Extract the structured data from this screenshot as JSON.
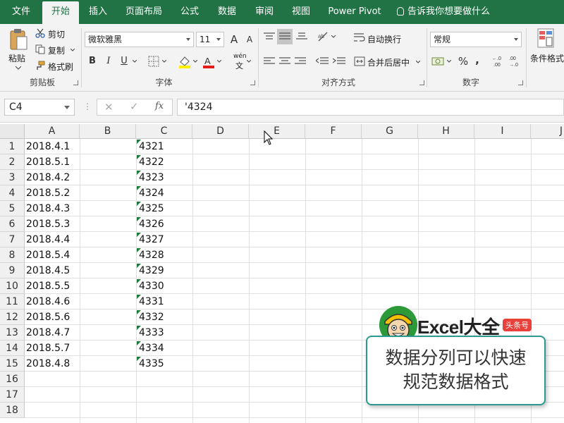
{
  "tabs": [
    {
      "label": "文件",
      "active": false
    },
    {
      "label": "开始",
      "active": true
    },
    {
      "label": "插入",
      "active": false
    },
    {
      "label": "页面布局",
      "active": false
    },
    {
      "label": "公式",
      "active": false
    },
    {
      "label": "数据",
      "active": false
    },
    {
      "label": "审阅",
      "active": false
    },
    {
      "label": "视图",
      "active": false
    },
    {
      "label": "Power Pivot",
      "active": false
    }
  ],
  "tell_me": "告诉我你想要做什么",
  "ribbon": {
    "clipboard": {
      "paste": "粘贴",
      "cut": "剪切",
      "copy": "复制",
      "format_painter": "格式刷",
      "label": "剪贴板"
    },
    "font": {
      "name": "微软雅黑",
      "size": "11",
      "grow": "A",
      "shrink": "A",
      "bold": "B",
      "italic": "I",
      "underline": "U",
      "wen": "wén",
      "wen_char": "文",
      "label": "字体"
    },
    "alignment": {
      "wrap": "自动换行",
      "merge": "合并后居中",
      "label": "对齐方式"
    },
    "number": {
      "format": "常规",
      "percent": "%",
      "comma": ",",
      "inc_decimal": "←.0\n.00",
      "dec_decimal": ".00\n→.0",
      "label": "数字"
    },
    "styles": {
      "conditional": "条件格式"
    }
  },
  "formula_bar": {
    "name_box": "C4",
    "cancel": "✕",
    "enter": "✓",
    "fx": "fx",
    "content": "'4324"
  },
  "columns": [
    "A",
    "B",
    "C",
    "D",
    "E",
    "F",
    "G",
    "H",
    "I",
    "J"
  ],
  "rows": [
    "1",
    "2",
    "3",
    "4",
    "5",
    "6",
    "7",
    "8",
    "9",
    "10",
    "11",
    "12",
    "13",
    "14",
    "15",
    "16",
    "17",
    "18"
  ],
  "cells": {
    "A": [
      "2018.4.1",
      "2018.5.1",
      "2018.4.2",
      "2018.5.2",
      "2018.4.3",
      "2018.5.3",
      "2018.4.4",
      "2018.5.4",
      "2018.4.5",
      "2018.5.5",
      "2018.4.6",
      "2018.5.6",
      "2018.4.7",
      "2018.5.7",
      "2018.4.8"
    ],
    "C": [
      "4321",
      "4322",
      "4323",
      "4324",
      "4325",
      "4326",
      "4327",
      "4328",
      "4329",
      "4330",
      "4331",
      "4332",
      "4333",
      "4334",
      "4335"
    ]
  },
  "overlay": {
    "logo_text": "Excel大全",
    "badge": "头条号",
    "callout_line1": "数据分列可以快速",
    "callout_line2": "规范数据格式"
  },
  "colors": {
    "excel_green": "#217346",
    "indicator_green": "#1e7b3a",
    "callout_border": "#2a9b8e",
    "badge_red": "#e8403a"
  }
}
